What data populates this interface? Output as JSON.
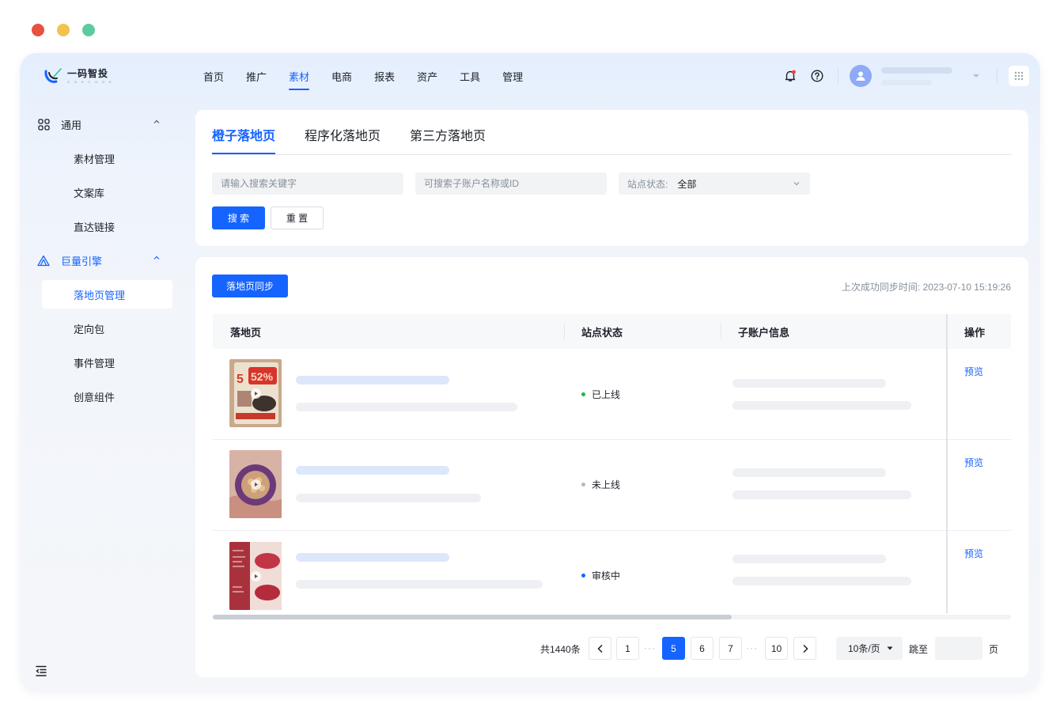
{
  "window": {
    "dots": [
      "#e8513f",
      "#f2c34e",
      "#5ecb9e"
    ]
  },
  "brand": {
    "name": "一码智投",
    "subtitle": "O N E C O D E"
  },
  "nav": [
    {
      "label": "首页"
    },
    {
      "label": "推广"
    },
    {
      "label": "素材",
      "active": true
    },
    {
      "label": "电商"
    },
    {
      "label": "报表"
    },
    {
      "label": "资产"
    },
    {
      "label": "工具"
    },
    {
      "label": "管理"
    }
  ],
  "header_icons": [
    "bell-icon",
    "help-icon",
    "avatar",
    "caret-down-icon",
    "apps-grid-icon"
  ],
  "sidebar": {
    "groups": [
      {
        "label": "通用",
        "icon": "apps-icon",
        "items": [
          "素材管理",
          "文案库",
          "直达链接"
        ]
      },
      {
        "label": "巨量引擎",
        "icon": "ocean-engine-icon",
        "items": [
          "落地页管理",
          "定向包",
          "事件管理",
          "创意组件"
        ],
        "active_item": "落地页管理"
      }
    ]
  },
  "tabs": [
    {
      "label": "橙子落地页",
      "active": true
    },
    {
      "label": "程序化落地页"
    },
    {
      "label": "第三方落地页"
    }
  ],
  "filters": {
    "keyword_placeholder": "请输入搜索关键字",
    "account_placeholder": "可搜索子账户名称或ID",
    "status_label": "站点状态:",
    "status_value": "全部",
    "search_label": "搜 索",
    "reset_label": "重 置"
  },
  "list": {
    "sync_button": "落地页同步",
    "sync_time_label": "上次成功同步时间:",
    "sync_time": "2023-07-10 15:19:26",
    "columns": [
      "落地页",
      "站点状态",
      "子账户信息",
      "操作"
    ],
    "rows": [
      {
        "status": "已上线",
        "status_color": "#20b542",
        "action": "预览",
        "thumb": "snack-pack-thumbnail"
      },
      {
        "status": "未上线",
        "status_color": "#b5b9bf",
        "action": "预览",
        "thumb": "capsule-jar-thumbnail"
      },
      {
        "status": "审核中",
        "status_color": "#1664ff",
        "action": "预览",
        "thumb": "lipstick-thumbnail"
      }
    ]
  },
  "pagination": {
    "total": "共1440条",
    "pages": [
      "1",
      "5",
      "6",
      "7",
      "10"
    ],
    "current": "5",
    "page_size": "10条/页",
    "jump_label": "跳至",
    "page_unit": "页"
  },
  "colors": {
    "accent": "#1664ff",
    "text": "#1d2129",
    "muted": "#86909c"
  }
}
